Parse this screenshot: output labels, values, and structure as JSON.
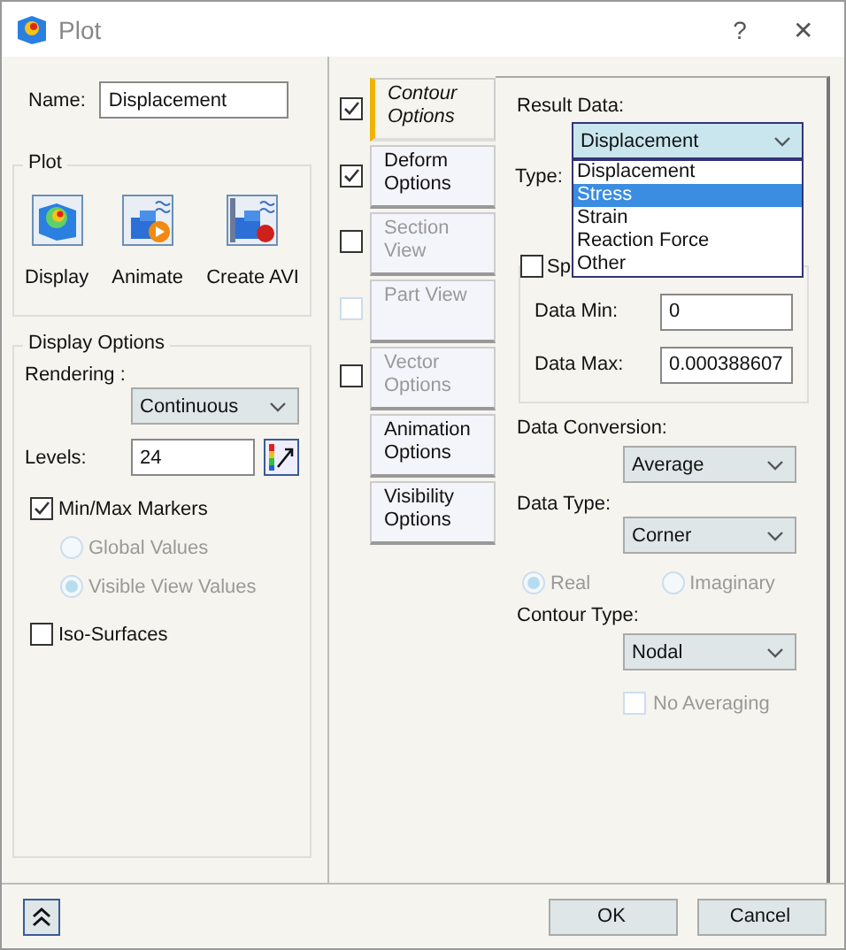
{
  "window": {
    "title": "Plot",
    "help": "?",
    "close": "✕"
  },
  "name": {
    "label": "Name:",
    "value": "Displacement"
  },
  "plot": {
    "title": "Plot",
    "buttons": [
      {
        "kind": "display",
        "label": "Display"
      },
      {
        "kind": "animate",
        "label": "Animate"
      },
      {
        "kind": "avi",
        "label": "Create AVI"
      }
    ]
  },
  "display_options": {
    "title": "Display Options",
    "rendering_label": "Rendering :",
    "rendering": "Continuous",
    "levels_label": "Levels:",
    "levels": "24",
    "min_max": {
      "label": "Min/Max Markers",
      "checked": true
    },
    "radios": [
      {
        "label": "Global Values",
        "selected": false,
        "disabled": true
      },
      {
        "label": "Visible View Values",
        "selected": true,
        "disabled": true
      }
    ],
    "iso": {
      "label": "Iso-Surfaces",
      "checked": false
    }
  },
  "tabs": [
    {
      "label": "Contour Options",
      "selected": true,
      "disabled": false,
      "checkbox": {
        "checked": true,
        "disabled": false
      }
    },
    {
      "label": "Deform Options",
      "selected": false,
      "disabled": false,
      "checkbox": {
        "checked": true,
        "disabled": false
      }
    },
    {
      "label": "Section View",
      "selected": false,
      "disabled": true,
      "checkbox": {
        "checked": false,
        "disabled": false
      }
    },
    {
      "label": "Part View",
      "selected": false,
      "disabled": true,
      "checkbox": {
        "checked": false,
        "disabled": true
      }
    },
    {
      "label": "Vector Options",
      "selected": false,
      "disabled": true,
      "checkbox": {
        "checked": false,
        "disabled": false
      }
    },
    {
      "label": "Animation Options",
      "selected": false,
      "disabled": false
    },
    {
      "label": "Visibility Options",
      "selected": false,
      "disabled": false
    }
  ],
  "contour": {
    "result_label": "Result Data:",
    "result": "Displacement",
    "result_options": [
      {
        "label": "Displacement",
        "selected": false
      },
      {
        "label": "Stress",
        "selected": true
      },
      {
        "label": "Strain",
        "selected": false
      },
      {
        "label": "Reaction Force",
        "selected": false
      },
      {
        "label": "Other",
        "selected": false
      }
    ],
    "type_label": "Type:",
    "specify": {
      "label": "Sp",
      "checked": false
    },
    "data_min_label": "Data Min:",
    "data_min": "0",
    "data_max_label": "Data Max:",
    "data_max": "0.000388607",
    "conversion_label": "Data Conversion:",
    "conversion": "Average",
    "data_type_label": "Data Type:",
    "data_type": "Corner",
    "complex": [
      {
        "label": "Real",
        "selected": true,
        "disabled": true
      },
      {
        "label": "Imaginary",
        "selected": false,
        "disabled": true
      }
    ],
    "contour_type_label": "Contour Type:",
    "contour_type": "Nodal",
    "no_averaging": {
      "label": "No Averaging",
      "checked": false,
      "disabled": true
    }
  },
  "footer": {
    "buttons": [
      "OK",
      "Cancel"
    ]
  }
}
